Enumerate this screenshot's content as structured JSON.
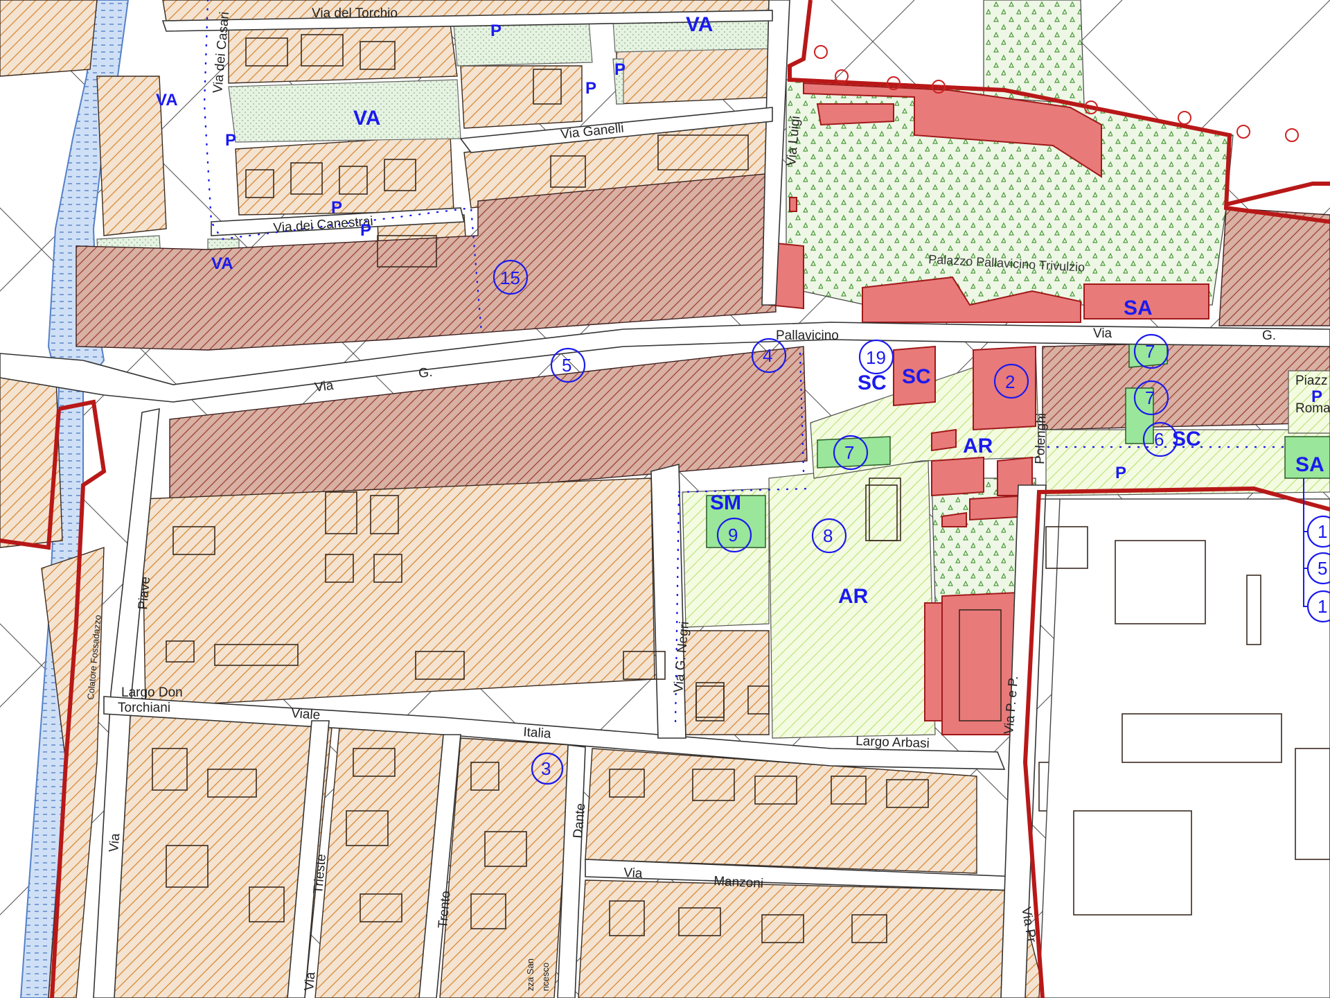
{
  "streets": {
    "via_del_torchio": "Via del Torchio",
    "via_dei_casari": "Via dei Casari",
    "via_ganelli": "Via Ganelli",
    "via_dei_canestrai": "Via dei Canestrai",
    "via_luigi": "Via Luigi",
    "via_g_pallavicino_via": "Via",
    "via_g_pallavicino_g": "G.",
    "via_g_pallavicino_name": "Pallavicino",
    "via_g_pallavicino_east_via": "Via",
    "via_g_pallavicino_east_g": "G.",
    "piave": "Piave",
    "colatore": "Colatore Fossadazzo",
    "largo_don": "Largo Don",
    "torchiani": "Torchiani",
    "viale": "Viale",
    "italia": "Italia",
    "via_g_negri": "Via G. Negri",
    "largo_arbasi": "Largo Arbasi",
    "polenghi": "Polenghi",
    "via_p_e_p": "Via P. e P.",
    "via_trieste": "Trieste",
    "via_trento": "Trento",
    "via_dante": "Dante",
    "via_manzoni_via": "Via",
    "via_manzoni": "Manzoni",
    "via_left": "Via",
    "via_trieste_via": "Via",
    "piazza_san": "zza San",
    "piazza_francesco": "ncesco",
    "via_pr": "Via Pr",
    "piazza_roma_1": "Piazz",
    "piazza_roma_2": "Roma"
  },
  "poi": {
    "palazzo": "Palazzo Pallavicino Trivulzio"
  },
  "zones": {
    "va1": "VA",
    "va2": "VA",
    "va3": "VA",
    "va4": "VA",
    "p1": "P",
    "p2": "P",
    "p3": "P",
    "p4": "P",
    "p5": "P",
    "p6": "P",
    "p7": "P",
    "sa1": "SA",
    "sa2": "SA",
    "sc1": "SC",
    "sc2": "SC",
    "sc3": "SC",
    "ar1": "AR",
    "ar2": "AR",
    "sm": "SM"
  },
  "markers": {
    "m15": "15",
    "m5": "5",
    "m4": "4",
    "m19": "19",
    "m2": "2",
    "m7a": "7",
    "m7b": "7",
    "m7c": "7",
    "m6": "6",
    "m9": "9",
    "m8": "8",
    "m3": "3",
    "m1a": "1",
    "m5b": "5",
    "m1b": "1"
  },
  "colors": {
    "historic_center": "#b05a4a",
    "residential": "#d9822b",
    "green": "#b5e06a",
    "monument": "#e87a7a",
    "service": "#9ae69a",
    "labels": "#1a1aee",
    "boundary": "#b81818"
  }
}
